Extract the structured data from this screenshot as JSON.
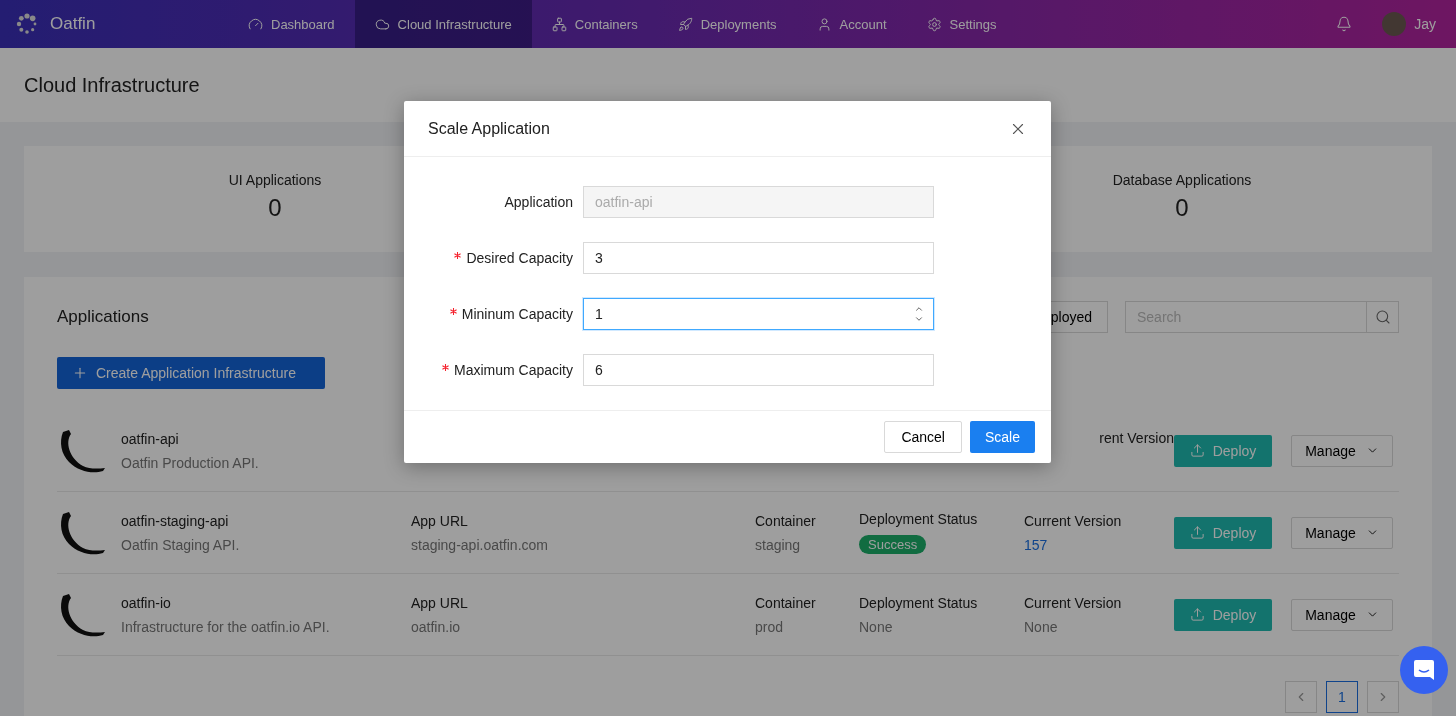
{
  "nav": {
    "brand": "Oatfin",
    "items": [
      {
        "label": "Dashboard",
        "selected": false
      },
      {
        "label": "Cloud Infrastructure",
        "selected": true
      },
      {
        "label": "Containers",
        "selected": false
      },
      {
        "label": "Deployments",
        "selected": false
      },
      {
        "label": "Account",
        "selected": false
      },
      {
        "label": "Settings",
        "selected": false
      }
    ],
    "user": "Jay"
  },
  "page_title": "Cloud Infrastructure",
  "stats": [
    {
      "label": "UI Applications",
      "value": "0"
    },
    {
      "label": "Database Applications",
      "value": "0"
    }
  ],
  "applications": {
    "title": "Applications",
    "create_button": "Create Application Infrastructure",
    "filter_button": "ployed",
    "search_placeholder": "Search",
    "rows": [
      {
        "name": "oatfin-api",
        "description": "Oatfin Production API.",
        "version_label": "rent Version",
        "deploy": "Deploy",
        "manage": "Manage"
      },
      {
        "name": "oatfin-staging-api",
        "description": "Oatfin Staging API.",
        "url_label": "App URL",
        "url": "staging-api.oatfin.com",
        "container_label": "Container",
        "container": "staging",
        "status_label": "Deployment Status",
        "status": {
          "text": "Success",
          "kind": "badge"
        },
        "version_label": "Current Version",
        "version": {
          "text": "157",
          "link": true
        },
        "deploy": "Deploy",
        "manage": "Manage"
      },
      {
        "name": "oatfin-io",
        "description": "Infrastructure for the oatfin.io API.",
        "url_label": "App URL",
        "url": "oatfin.io",
        "container_label": "Container",
        "container": "prod",
        "status_label": "Deployment Status",
        "status": {
          "text": "None",
          "kind": "plain"
        },
        "version_label": "Current Version",
        "version": {
          "text": "None",
          "link": false
        },
        "deploy": "Deploy",
        "manage": "Manage"
      }
    ],
    "pages": [
      {
        "label": "1",
        "selected": true
      }
    ]
  },
  "modal": {
    "title": "Scale Application",
    "fields": [
      {
        "label": "Application",
        "required": false,
        "value": "oatfin-api",
        "disabled": true,
        "focused": false,
        "kind": "text"
      },
      {
        "label": "Desired Capacity",
        "required": true,
        "value": "3",
        "disabled": false,
        "focused": false,
        "kind": "text"
      },
      {
        "label": "Mininum Capacity",
        "required": true,
        "value": "1",
        "disabled": false,
        "focused": true,
        "kind": "number"
      },
      {
        "label": "Maximum Capacity",
        "required": true,
        "value": "6",
        "disabled": false,
        "focused": false,
        "kind": "text"
      }
    ],
    "cancel": "Cancel",
    "confirm": "Scale"
  }
}
